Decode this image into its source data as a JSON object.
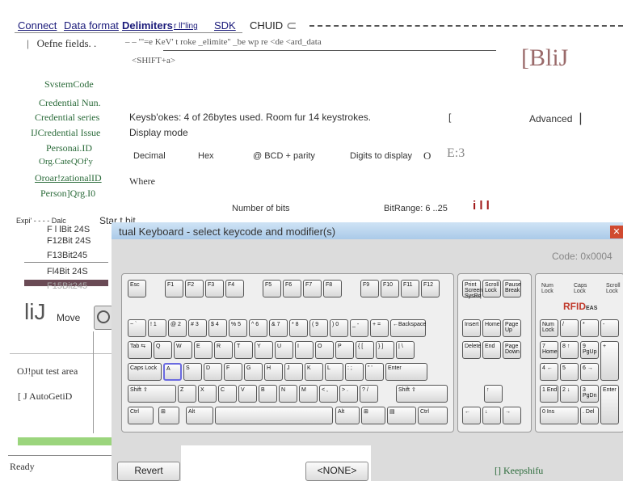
{
  "menu": [
    "Connect",
    "Data format",
    "Delimiters",
    "r ll\"ling",
    "SDK",
    "CHUID"
  ],
  "define_fields": "Oefne fields. .",
  "keystroke_line": "– – \"'=e          KeV' t roke _elimite'' _be wp re <de <ard_data",
  "shift_label": "<SHIFT+a>",
  "logo_text": "[BliJ",
  "fields": [
    "SvstemCode",
    "Credential Nun.",
    "Credential series",
    "IJCredential Issue",
    "Personai.ID",
    "Org.CateQOf'y",
    "Oroar!zationalID",
    "Person]Qrg.I0"
  ],
  "bytes_info": "Keysb'okes: 4 of 26bytes used. Room fur 14 keystrokes.",
  "bracket": "[",
  "advanced": "Advanced",
  "display_mode": "Display mode",
  "modes": [
    "Decimal",
    "Hex",
    "@ BCD + parity"
  ],
  "digits_label": "Digits to display",
  "digits_value": "O",
  "digits_e": "E:3",
  "where": "Where",
  "number_of_bits": "Number of bits",
  "bit_range": "BitRange: 6 ..25",
  "bit_marks": "i l l",
  "expi": "Expi' - - - - Dalc",
  "start_bit": "Star t bit",
  "bits_list": [
    "F l lBit 24S",
    "F12Bit 24S",
    "F13Bit245",
    "Fl4Bit 24S",
    "F15Bit245"
  ],
  "big_ij": "liJ",
  "move": "Move",
  "output_area": "OJ!put test area",
  "auto_get": "[ J AutoGetiD",
  "ready": "Ready",
  "kb_title": "tual Keyboard - select keycode and modifier(s)",
  "code": "Code: 0x0004",
  "leds": [
    "Num Lock",
    "Caps Lock",
    "Scroll Lock"
  ],
  "rfid": "RFID",
  "rfid_sub": "EAS",
  "revert": "Revert",
  "none": "<NONE>",
  "keepshift": "[] Keepshifu",
  "close_icon": "close-icon",
  "keys": {
    "fn": [
      "Esc",
      "F1",
      "F2",
      "F3",
      "F4",
      "F5",
      "F6",
      "F7",
      "F8",
      "F9",
      "F10",
      "F11",
      "F12"
    ],
    "special": [
      "Print Screen SysRq",
      "Scroll Lock",
      "Pause Break"
    ],
    "num": [
      "~ `",
      "! 1",
      "@ 2",
      "# 3",
      "$ 4",
      "% 5",
      "^ 6",
      "& 7",
      "* 8",
      "( 9",
      ") 0",
      "_ -",
      "+ =",
      "←Backspace"
    ],
    "top": [
      "Tab ⇆",
      "Q",
      "W",
      "E",
      "R",
      "T",
      "Y",
      "U",
      "I",
      "O",
      "P",
      "{ [",
      "} ]",
      "| \\"
    ],
    "home": [
      "Caps Lock",
      "A",
      "S",
      "D",
      "F",
      "G",
      "H",
      "J",
      "K",
      "L",
      ": ;",
      "\" '",
      "Enter"
    ],
    "shiftrow": [
      "Shift ⇧",
      "Z",
      "X",
      "C",
      "V",
      "B",
      "N",
      "M",
      "< ,",
      "> .",
      "? /",
      "Shift ⇧"
    ],
    "bottom": [
      "Ctrl",
      "⊞",
      "Alt",
      "",
      "Alt",
      "⊞",
      "▤",
      "Ctrl"
    ],
    "nav": [
      "Insert",
      "Home",
      "Page Up",
      "Delete",
      "End",
      "Page Down"
    ],
    "arrows": [
      "↑",
      "←",
      "↓",
      "→"
    ],
    "pad": [
      "Num Lock",
      "/",
      "*",
      "-",
      "7 Home",
      "8 ↑",
      "9 PgUp",
      "+",
      "4 ←",
      "5",
      "6 →",
      "1 End",
      "2 ↓",
      "3 PgDn",
      "Enter",
      "0 Ins",
      ". Del"
    ]
  }
}
